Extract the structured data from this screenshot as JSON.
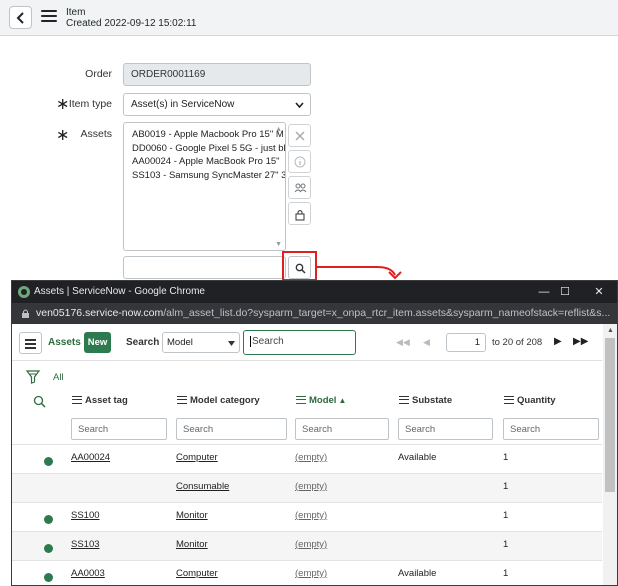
{
  "form": {
    "header": {
      "title": "Item",
      "subtitle": "Created 2022-09-12 15:02:11"
    },
    "order": {
      "label": "Order",
      "value": "ORDER0001169"
    },
    "item_type": {
      "label": "Item type",
      "value": "Asset(s) in ServiceNow",
      "required_mark": "∗"
    },
    "assets": {
      "label": "Assets",
      "required_mark": "∗",
      "lines": [
        "AB0019 - Apple Macbook Pro 15\" M",
        "DD0060 - Google Pixel 5 5G - just bl",
        "AA00024 - Apple MacBook Pro 15\"",
        "SS103 - Samsung SyncMaster 27\" 3"
      ]
    }
  },
  "popup": {
    "window_title": "Assets | ServiceNow - Google Chrome",
    "url_host": "ven05176.service-now.com",
    "url_path": "/alm_asset_list.do?sysparm_target=x_onpa_rtcr_item.assets&sysparm_nameofstack=reflist&s...",
    "list_title": "Assets",
    "new_label": "New",
    "search_label": "Search",
    "search_field": "Model",
    "search_placeholder": "Search",
    "pager": {
      "page": "1",
      "range_text": "to 20 of 208"
    },
    "filter_all": "All",
    "columns": [
      "Asset tag",
      "Model category",
      "Model",
      "Substate",
      "Quantity"
    ],
    "column_search_placeholder": "Search",
    "rows": [
      {
        "asset_tag": "AA00024",
        "model_category": "Computer",
        "model": "(empty)",
        "substate": "Available",
        "quantity": "1"
      },
      {
        "asset_tag": "",
        "model_category": "Consumable",
        "model": "(empty)",
        "substate": "",
        "quantity": "1"
      },
      {
        "asset_tag": "SS100",
        "model_category": "Monitor",
        "model": "(empty)",
        "substate": "",
        "quantity": "1"
      },
      {
        "asset_tag": "SS103",
        "model_category": "Monitor",
        "model": "(empty)",
        "substate": "",
        "quantity": "1"
      },
      {
        "asset_tag": "AA0003",
        "model_category": "Computer",
        "model": "(empty)",
        "substate": "Available",
        "quantity": "1"
      }
    ]
  },
  "colors": {
    "accent_green": "#2d7a4f",
    "highlight_red": "#e02020",
    "chrome_dark": "#202124"
  }
}
